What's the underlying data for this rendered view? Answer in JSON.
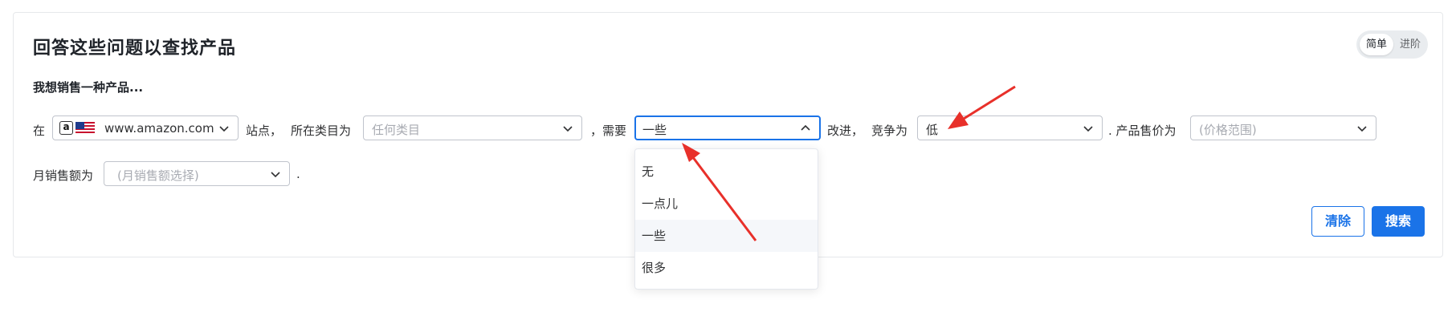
{
  "header": {
    "title": "回答这些问题以查找产品"
  },
  "mode_toggle": {
    "simple_label": "简单",
    "advanced_label": "进阶",
    "selected": "简单"
  },
  "form": {
    "intro": "我想销售一种产品...",
    "prefix_in": "在",
    "site_select": {
      "value": "www.amazon.com",
      "icon": "amazon-icon",
      "flag": "us-flag-icon"
    },
    "after_site": "站点，",
    "category_label": "所在类目为",
    "category_select": {
      "placeholder": "任何类目"
    },
    "comma": "，",
    "need_label": "需要",
    "improvement_select": {
      "value": "一些",
      "open": true
    },
    "after_improvement": "改进，",
    "competition_label": "竞争为",
    "competition_select": {
      "value": "低"
    },
    "price_label": ". 产品售价为",
    "price_select": {
      "placeholder": "(价格范围)"
    },
    "sales_label": "月销售额为",
    "sales_select": {
      "placeholder": "(月销售额选择)"
    },
    "period": "."
  },
  "dropdown": {
    "options": [
      "无",
      "一点儿",
      "一些",
      "很多"
    ],
    "selected": "一些"
  },
  "buttons": {
    "clear_label": "清除",
    "search_label": "搜索"
  },
  "colors": {
    "primary": "#1a73e8",
    "annotation_arrow": "#e8302a"
  }
}
